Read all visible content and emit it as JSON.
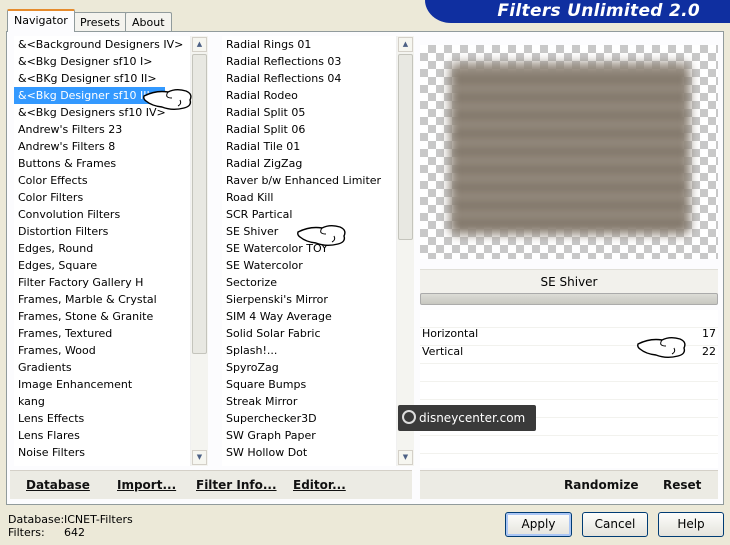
{
  "window": {
    "title": "Filters Unlimited 2.0"
  },
  "tabs": [
    {
      "label": "Navigator",
      "active": true
    },
    {
      "label": "Presets",
      "active": false
    },
    {
      "label": "About",
      "active": false
    }
  ],
  "categories": {
    "selected_index": 3,
    "items": [
      "&<Background Designers IV>",
      "&<Bkg Designer sf10 I>",
      "&<BKg Designer sf10 II>",
      "&<Bkg Designer sf10 III>",
      "&<Bkg Designers sf10 IV>",
      "Andrew's Filters 23",
      "Andrew's Filters 8",
      "Buttons & Frames",
      "Color Effects",
      "Color Filters",
      "Convolution Filters",
      "Distortion Filters",
      "Edges, Round",
      "Edges, Square",
      "Filter Factory Gallery H",
      "Frames, Marble & Crystal",
      "Frames, Stone & Granite",
      "Frames, Textured",
      "Frames, Wood",
      "Gradients",
      "Image Enhancement",
      "kang",
      "Lens Effects",
      "Lens Flares",
      "Noise Filters"
    ]
  },
  "filters": {
    "items": [
      "Radial  Rings 01",
      "Radial Reflections 03",
      "Radial Reflections 04",
      "Radial Rodeo",
      "Radial Split 05",
      "Radial Split 06",
      "Radial Tile 01",
      "Radial ZigZag",
      "Raver b/w Enhanced Limiter",
      "Road Kill",
      "SCR  Partical",
      "SE Shiver",
      "SE Watercolor TOY",
      "SE Watercolor",
      "Sectorize",
      "Sierpenski's Mirror",
      "SIM 4 Way Average",
      "Solid Solar Fabric",
      "Splash!...",
      "SpyroZag",
      "Square Bumps",
      "Streak Mirror",
      "Superchecker3D",
      "SW Graph Paper",
      "SW Hollow Dot"
    ]
  },
  "left_links": {
    "database": "Database",
    "import": "Import...",
    "filter_info": "Filter Info...",
    "editor": "Editor..."
  },
  "right_links": {
    "randomize": "Randomize",
    "reset": "Reset"
  },
  "preview": {
    "filter_name": "SE Shiver"
  },
  "params": [
    {
      "label": "Horizontal",
      "value": "17"
    },
    {
      "label": "Vertical",
      "value": "22"
    }
  ],
  "status": {
    "db_label": "Database:",
    "db_value": "ICNET-Filters",
    "filters_label": "Filters:",
    "filters_value": "642"
  },
  "buttons": {
    "apply": "Apply",
    "cancel": "Cancel",
    "help": "Help"
  },
  "watermark": {
    "text": "disneycenter.com"
  }
}
